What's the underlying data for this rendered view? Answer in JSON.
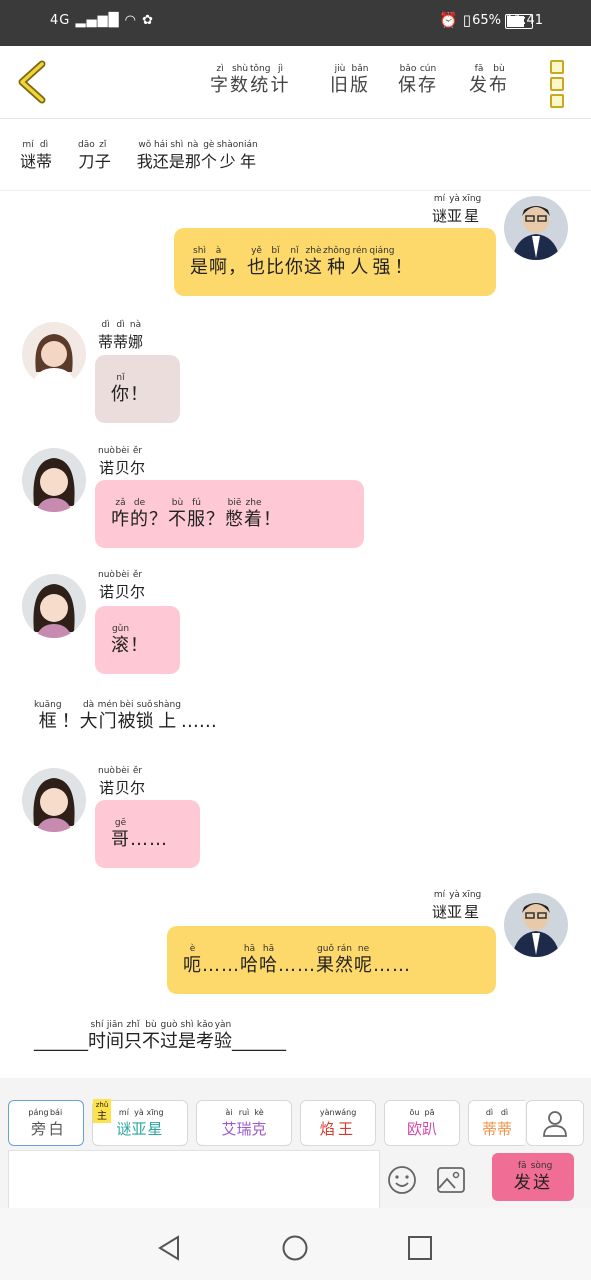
{
  "status": {
    "signal": "4G",
    "battery": "65%",
    "time": "11:41"
  },
  "toolbar": {
    "items": [
      {
        "py": [
          "zì",
          "shù",
          "tǒng",
          "jì"
        ],
        "hz": [
          "字",
          "数",
          "统",
          "计"
        ]
      },
      {
        "py": [
          "jiù",
          "bǎn"
        ],
        "hz": [
          "旧",
          "版"
        ]
      },
      {
        "py": [
          "bǎo",
          "cún"
        ],
        "hz": [
          "保",
          "存"
        ]
      },
      {
        "py": [
          "fā",
          "bù"
        ],
        "hz": [
          "发",
          "布"
        ]
      }
    ]
  },
  "title": {
    "parts": [
      {
        "py": [
          "mí",
          "dì"
        ],
        "hz": [
          "谜",
          "蒂"
        ]
      },
      {
        "py": [
          "dāo",
          "zǐ"
        ],
        "hz": [
          "刀",
          "子"
        ]
      },
      {
        "py": [
          "wǒ",
          "hái",
          "shì",
          "nà",
          "gè",
          "shào",
          "nián"
        ],
        "hz": [
          "我",
          "还",
          "是",
          "那",
          "个",
          "少",
          "年"
        ]
      }
    ]
  },
  "messages": [
    {
      "name": {
        "py": [
          "mí",
          "yà",
          "xīng"
        ],
        "hz": [
          "谜",
          "亚",
          "星"
        ]
      },
      "text": {
        "py": [
          "shì",
          "à",
          "",
          "yě",
          "bǐ",
          "nǐ",
          "zhè",
          "zhǒng",
          "rén",
          "qiáng",
          ""
        ],
        "hz": [
          "是",
          "啊",
          "，",
          "也",
          "比",
          "你",
          "这",
          "种",
          "人",
          "强",
          "！"
        ]
      },
      "color": "#fdd86a"
    },
    {
      "name": {
        "py": [
          "dì",
          "dì",
          "nà"
        ],
        "hz": [
          "蒂",
          "蒂",
          "娜"
        ]
      },
      "text": {
        "py": [
          "nǐ",
          ""
        ],
        "hz": [
          "你",
          "！"
        ]
      },
      "color": "#ecdddd"
    },
    {
      "name": {
        "py": [
          "nuò",
          "bèi",
          "ěr"
        ],
        "hz": [
          "诺",
          "贝",
          "尔"
        ]
      },
      "text": {
        "py": [
          "zǎ",
          "de",
          "",
          "bù",
          "fú",
          "",
          "biē",
          "zhe",
          ""
        ],
        "hz": [
          "咋",
          "的",
          "？",
          "不",
          "服",
          "？",
          "憋",
          "着",
          "！"
        ]
      },
      "color": "#fec8d4"
    },
    {
      "name": {
        "py": [
          "nuò",
          "bèi",
          "ěr"
        ],
        "hz": [
          "诺",
          "贝",
          "尔"
        ]
      },
      "text": {
        "py": [
          "gǔn",
          ""
        ],
        "hz": [
          "滚",
          "！"
        ]
      },
      "color": "#fec8d4"
    },
    {
      "name": {
        "py": [
          "nuò",
          "bèi",
          "ěr"
        ],
        "hz": [
          "诺",
          "贝",
          "尔"
        ]
      },
      "text": {
        "py": [
          "gē",
          ""
        ],
        "hz": [
          "哥",
          "……"
        ]
      },
      "color": "#fec8d4"
    },
    {
      "name": {
        "py": [
          "mí",
          "yà",
          "xīng"
        ],
        "hz": [
          "谜",
          "亚",
          "星"
        ]
      },
      "text": {
        "py": [
          "è",
          "",
          "hā",
          "hā",
          "",
          "guǒ",
          "rán",
          "ne",
          ""
        ],
        "hz": [
          "呃",
          "……",
          "哈",
          "哈",
          "……",
          "果",
          "然",
          "呢",
          "……"
        ]
      },
      "color": "#fdd86a"
    }
  ],
  "narration1": {
    "py": [
      "kuāng",
      "",
      "dà",
      "mén",
      "bèi",
      "suǒ",
      "shàng",
      ""
    ],
    "hz": [
      "框",
      "！",
      "大",
      "门",
      "被",
      "锁",
      "上",
      "……"
    ]
  },
  "narration2": {
    "py": [
      "",
      "shí",
      "jiān",
      "zhǐ",
      "bù",
      "guò",
      "shì",
      "kǎo",
      "yàn",
      ""
    ],
    "hz": [
      "______",
      "时",
      "间",
      "只",
      "不",
      "过",
      "是",
      "考",
      "验",
      "______"
    ]
  },
  "chips": [
    {
      "py": [
        "páng",
        "bái"
      ],
      "hz": [
        "旁",
        "白"
      ],
      "color": "#555"
    },
    {
      "py": [
        "mí",
        "yà",
        "xīng"
      ],
      "hz": [
        "谜",
        "亚",
        "星"
      ],
      "color": "#2aa7a0",
      "badge": {
        "py": "zhǔ",
        "hz": "主"
      }
    },
    {
      "py": [
        "ài",
        "ruì",
        "kè"
      ],
      "hz": [
        "艾",
        "瑞",
        "克"
      ],
      "color": "#9b59d0"
    },
    {
      "py": [
        "yàn",
        "wáng"
      ],
      "hz": [
        "焰",
        "王"
      ],
      "color": "#d23a2a"
    },
    {
      "py": [
        "ōu",
        "pā"
      ],
      "hz": [
        "欧",
        "趴"
      ],
      "color": "#d64aa8"
    },
    {
      "py": [
        "dì",
        "dì"
      ],
      "hz": [
        "蒂",
        "蒂"
      ],
      "color": "#f0924a"
    }
  ],
  "send": {
    "py": [
      "fā",
      "sòng"
    ],
    "hz": [
      "发",
      "送"
    ]
  }
}
